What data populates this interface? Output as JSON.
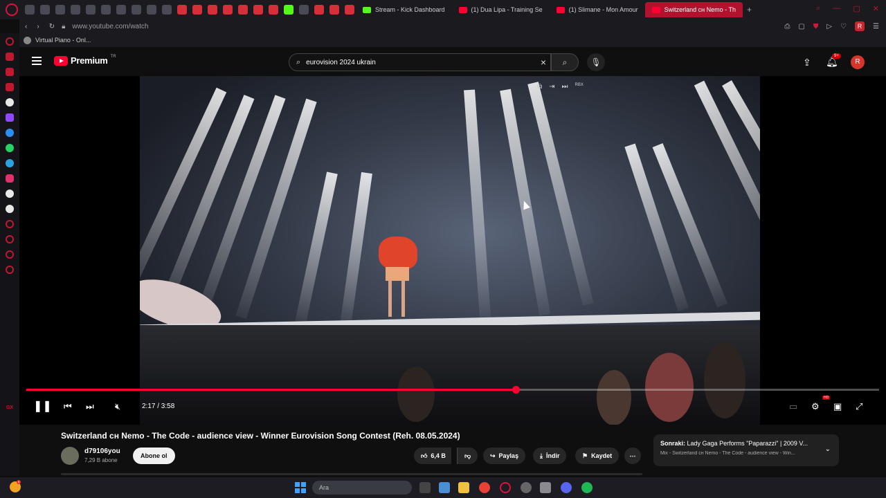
{
  "browser": {
    "tabs": [
      {
        "label": "Stream - Kick Dashboard",
        "type": "kick"
      },
      {
        "label": "(1) Dua Lipa - Training Se",
        "type": "yt"
      },
      {
        "label": "(1) Slimane - Mon Amour",
        "type": "yt"
      },
      {
        "label": "Switzerland ᴄʜ Nemo - Th",
        "type": "yt",
        "active": true
      }
    ],
    "url": "www.youtube.com/watch",
    "bookmark": "Virtual Piano - Onl...",
    "profile_initial": "R"
  },
  "youtube": {
    "brand": "Premium",
    "country_code": "TR",
    "search_value": "eurovision 2024 ukrain",
    "notifications_badge": "9+",
    "avatar_initial": "R"
  },
  "player": {
    "time_display": "2:17 / 3:58",
    "progress": 0.574,
    "pip_label": "RBX"
  },
  "video": {
    "title": "Switzerland ᴄʜ Nemo - The Code - audience view - Winner Eurovision Song Contest (Reh. 08.05.2024)",
    "channel": "d79106you",
    "subscribers": "7,29 B abone",
    "subscribe_label": "Abone ol",
    "likes": "6,4 B",
    "share_label": "Paylaş",
    "download_label": "İndir",
    "save_label": "Kaydet"
  },
  "up_next": {
    "prefix": "Sonraki:",
    "title": "Lady Gaga Performs \"Paparazzi\" | 2009 V...",
    "subtitle": "Mix - Switzerland ᴄʜ Nemo - The Code - audience view - Win..."
  },
  "taskbar": {
    "search_placeholder": "Ara",
    "notification_count": "5"
  },
  "colors": {
    "accent": "#ff0033",
    "opera_red": "#c0182f",
    "background": "#0f0f0f"
  }
}
